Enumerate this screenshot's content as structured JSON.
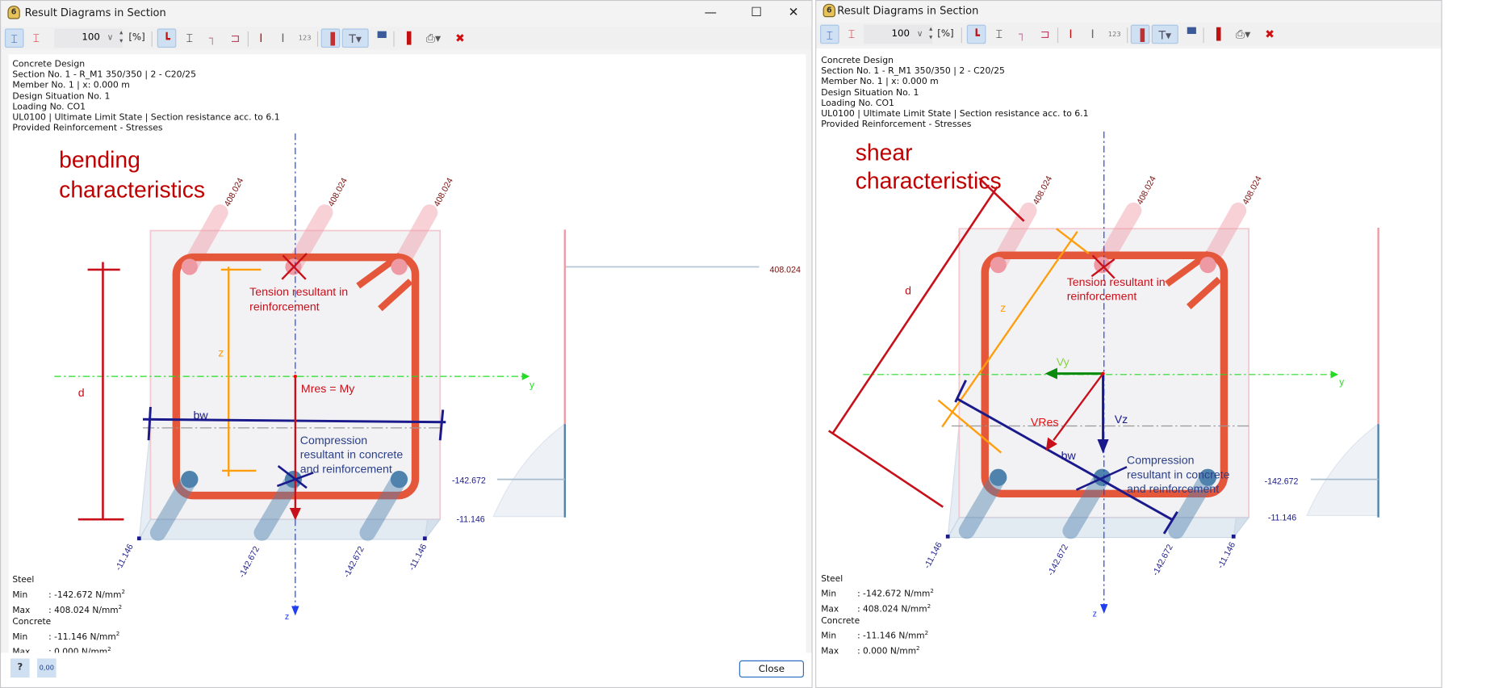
{
  "left_window": {
    "title": "Result Diagrams in Section",
    "controls": {
      "minimize": "—",
      "maximize": "☐",
      "close": "✕"
    },
    "toolbar": {
      "zoom_value": "100",
      "zoom_unit": "[%]"
    },
    "info_lines": [
      "Concrete Design",
      "Section No. 1 - R_M1 350/350 | 2 - C20/25",
      "Member No. 1 | x: 0.000 m",
      "Design Situation No. 1",
      "Loading No. CO1",
      "UL0100 | Ultimate Limit State | Section resistance acc. to 6.1",
      "Provided Reinforcement - Stresses"
    ],
    "diagram": {
      "heading_line1": "bending",
      "heading_line2": "characteristics",
      "tension_line1": "Tension resultant in",
      "tension_line2": "reinforcement",
      "compression_line1": "Compression",
      "compression_line2": "resultant in concrete",
      "compression_line3": "and reinforcement",
      "d_label": "d",
      "z_label": "z",
      "bw_label": "bw",
      "moment_label": "Mres = My",
      "y_axis": "y",
      "z_axis": "z",
      "stress_max_label": "408.024",
      "stress_min_label": "-142.672",
      "concrete_min_label": "-11.146"
    },
    "stats": {
      "steel_title": "Steel",
      "steel_min_label": "Min",
      "steel_min": ": -142.672 N/mm",
      "steel_max_label": "Max",
      "steel_max": ":  408.024 N/mm",
      "concrete_title": "Concrete",
      "concrete_min_label": "Min",
      "concrete_min": ":  -11.146 N/mm",
      "concrete_max_label": "Max",
      "concrete_max": ":      0.000 N/mm",
      "sup": "2"
    },
    "footer": {
      "decimals_icon_text": "0,00",
      "close_label": "Close"
    }
  },
  "right_window": {
    "title": "Result Diagrams in Section",
    "toolbar": {
      "zoom_value": "100",
      "zoom_unit": "[%]"
    },
    "info_lines": [
      "Concrete Design",
      "Section No. 1 - R_M1 350/350 | 2 - C20/25",
      "Member No. 1 | x: 0.000 m",
      "Design Situation No. 1",
      "Loading No. CO1",
      "UL0100 | Ultimate Limit State | Section resistance acc. to 6.1",
      "Provided Reinforcement - Stresses"
    ],
    "diagram": {
      "heading_line1": "shear",
      "heading_line2": "characteristics",
      "tension_line1": "Tension resultant in",
      "tension_line2": "reinforcement",
      "compression_line1": "Compression",
      "compression_line2": "resultant in concrete",
      "compression_line3": "and reinforcement",
      "d_label": "d",
      "z_label": "z",
      "bw_label": "bw",
      "vy_label": "Vy",
      "vz_label": "Vz",
      "vres_label": "VRes",
      "y_axis": "y",
      "z_axis": "z",
      "stress_min_label": "-142.672",
      "concrete_min_label": "-11.146"
    },
    "stats": {
      "steel_title": "Steel",
      "steel_min_label": "Min",
      "steel_min": ": -142.672 N/mm",
      "steel_max_label": "Max",
      "steel_max": ":  408.024 N/mm",
      "concrete_title": "Concrete",
      "concrete_min_label": "Min",
      "concrete_min": ":  -11.146 N/mm",
      "concrete_max_label": "Max",
      "concrete_max": ":      0.000 N/mm",
      "sup": "2"
    }
  },
  "bar_stresses": {
    "top": [
      "408.024",
      "408.024",
      "408.024"
    ],
    "bottom": [
      "-11.146",
      "-142.672",
      "-142.672",
      "-11.146"
    ]
  },
  "colors": {
    "stirrup": "#e5573b",
    "tension": "#c8101a",
    "compression": "#1a1a8c",
    "lever_arm": "#ff9e0d",
    "y_axis": "#22dd22",
    "z_axis": "#1f3ff0",
    "top_bar": "#ee9aa4",
    "bottom_bar": "#4f83ad",
    "heading": "#c00000"
  },
  "icons": [
    "section-numbering-icon",
    "section-numbers-icon",
    "fit-icon",
    "dimension-icon",
    "axes-icon",
    "shear-center-icon",
    "member-icon",
    "member-outline-icon",
    "numbering-icon",
    "stresses-icon",
    "diagram-icon",
    "color-scale-icon",
    "info-icon",
    "print-icon",
    "reset-zoom-icon",
    "help-icon",
    "decimals-icon"
  ]
}
